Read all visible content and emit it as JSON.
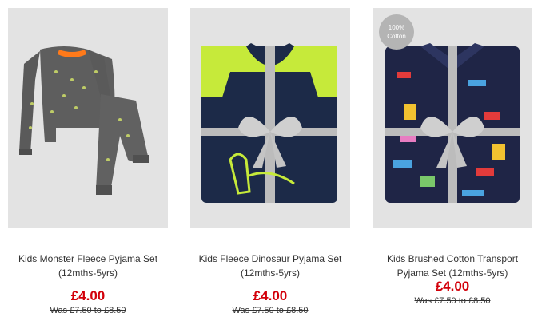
{
  "products": [
    {
      "name": "Kids Monster Fleece Pyjama Set (12mths-5yrs)",
      "price": "£4.00",
      "was_price": "Was £7.50 to £8.50"
    },
    {
      "name": "Kids Fleece Dinosaur Pyjama Set (12mths-5yrs)",
      "price": "£4.00",
      "was_price": "Was £7.50 to £8.50"
    },
    {
      "name": "Kids Brushed Cotton Transport Pyjama Set (12mths-5yrs)",
      "price": "£4.00",
      "was_price": "Was £7.50 to £8.50",
      "badge_line1": "100%",
      "badge_line2": "Cotton"
    }
  ],
  "colors": {
    "image_bg": "#e3e3e3",
    "price": "#d2000a",
    "badge": "#b4b4b4"
  }
}
